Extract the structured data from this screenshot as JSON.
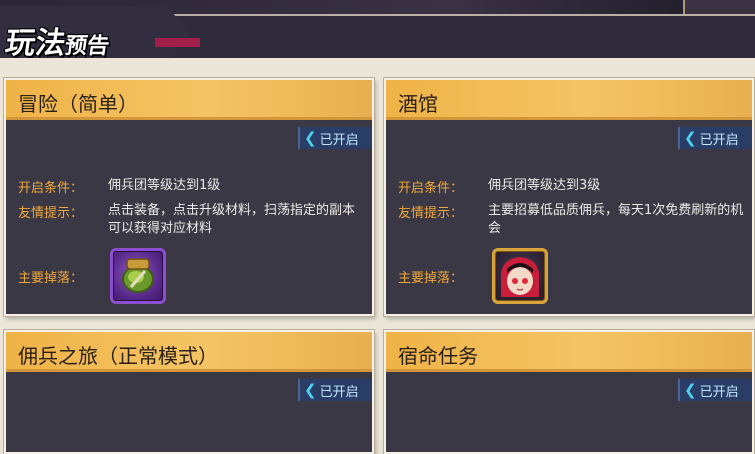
{
  "title": {
    "big": "玩法",
    "small": "预告"
  },
  "cards": [
    {
      "title": "冒险（简单）",
      "status": "已开启",
      "open_label": "开启条件：",
      "open_value": "佣兵团等级达到1级",
      "tip_label": "友情提示：",
      "tip_value": "点击装备，点击升级材料，扫荡指定的副本可以获得对应材料",
      "drop_label": "主要掉落：",
      "drop_icon": "green-shield-item-icon"
    },
    {
      "title": "酒馆",
      "status": "已开启",
      "open_label": "开启条件：",
      "open_value": "佣兵团等级达到3级",
      "tip_label": "友情提示：",
      "tip_value": "主要招募低品质佣兵，每天1次免费刷新的机会",
      "drop_label": "主要掉落：",
      "drop_icon": "red-hair-hero-portrait-icon"
    },
    {
      "title": "佣兵之旅（正常模式）",
      "status": "已开启"
    },
    {
      "title": "宿命任务",
      "status": "已开启"
    }
  ],
  "colors": {
    "header_gold": "#f4c465",
    "card_body": "#3a3844",
    "label_orange": "#f0a83a",
    "badge_bg": "#2a3d66",
    "badge_chevron": "#4fd2f0"
  }
}
